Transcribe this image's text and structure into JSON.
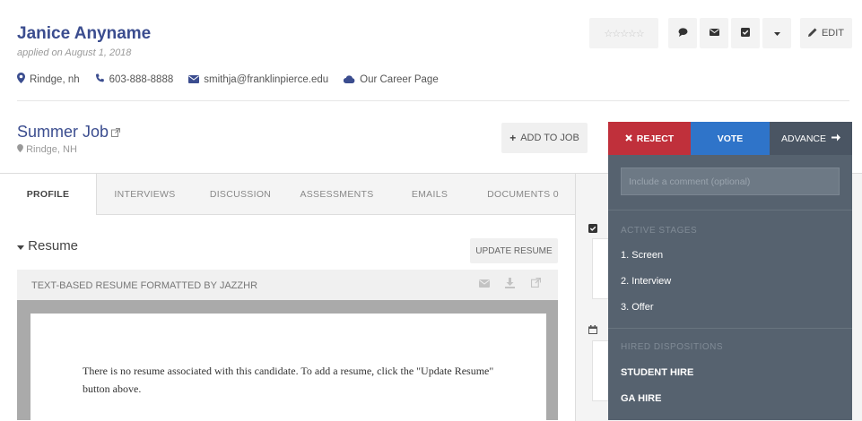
{
  "candidate": {
    "name": "Janice Anyname",
    "applied": "applied on August 1, 2018",
    "location": "Rindge, nh",
    "phone": "603-888-8888",
    "email": "smithja@franklinpierce.edu",
    "career_page": "Our Career Page"
  },
  "toolbar": {
    "stars": "☆☆☆☆☆",
    "edit_label": "EDIT"
  },
  "job": {
    "title": "Summer Job",
    "location": "Rindge, NH",
    "add_to_job_label": "ADD TO JOB"
  },
  "tabs": [
    {
      "label": "PROFILE"
    },
    {
      "label": "INTERVIEWS"
    },
    {
      "label": "DISCUSSION"
    },
    {
      "label": "ASSESSMENTS"
    },
    {
      "label": "EMAILS"
    },
    {
      "label": "DOCUMENTS 0"
    }
  ],
  "resume": {
    "heading": "Resume",
    "update_label": "UPDATE RESUME",
    "bar_title": "TEXT-BASED RESUME FORMATTED BY JAZZHR",
    "empty_text": "There is no resume associated with this candidate. To add a resume, click the \"Update Resume\" button above."
  },
  "actions": {
    "reject_label": "REJECT",
    "vote_label": "VOTE",
    "advance_label": "ADVANCE"
  },
  "dropdown": {
    "comment_placeholder": "Include a comment (optional)",
    "active_stages_header": "ACTIVE STAGES",
    "stages": [
      "1. Screen",
      "2. Interview",
      "3. Offer"
    ],
    "hired_header": "HIRED DISPOSITIONS",
    "hired": [
      "STUDENT HIRE",
      "GA HIRE"
    ]
  },
  "colors": {
    "brand": "#3b4d8f",
    "reject": "#c0303b",
    "vote": "#2f74c9",
    "advance": "#4a5563",
    "dropdown": "#56626f"
  }
}
